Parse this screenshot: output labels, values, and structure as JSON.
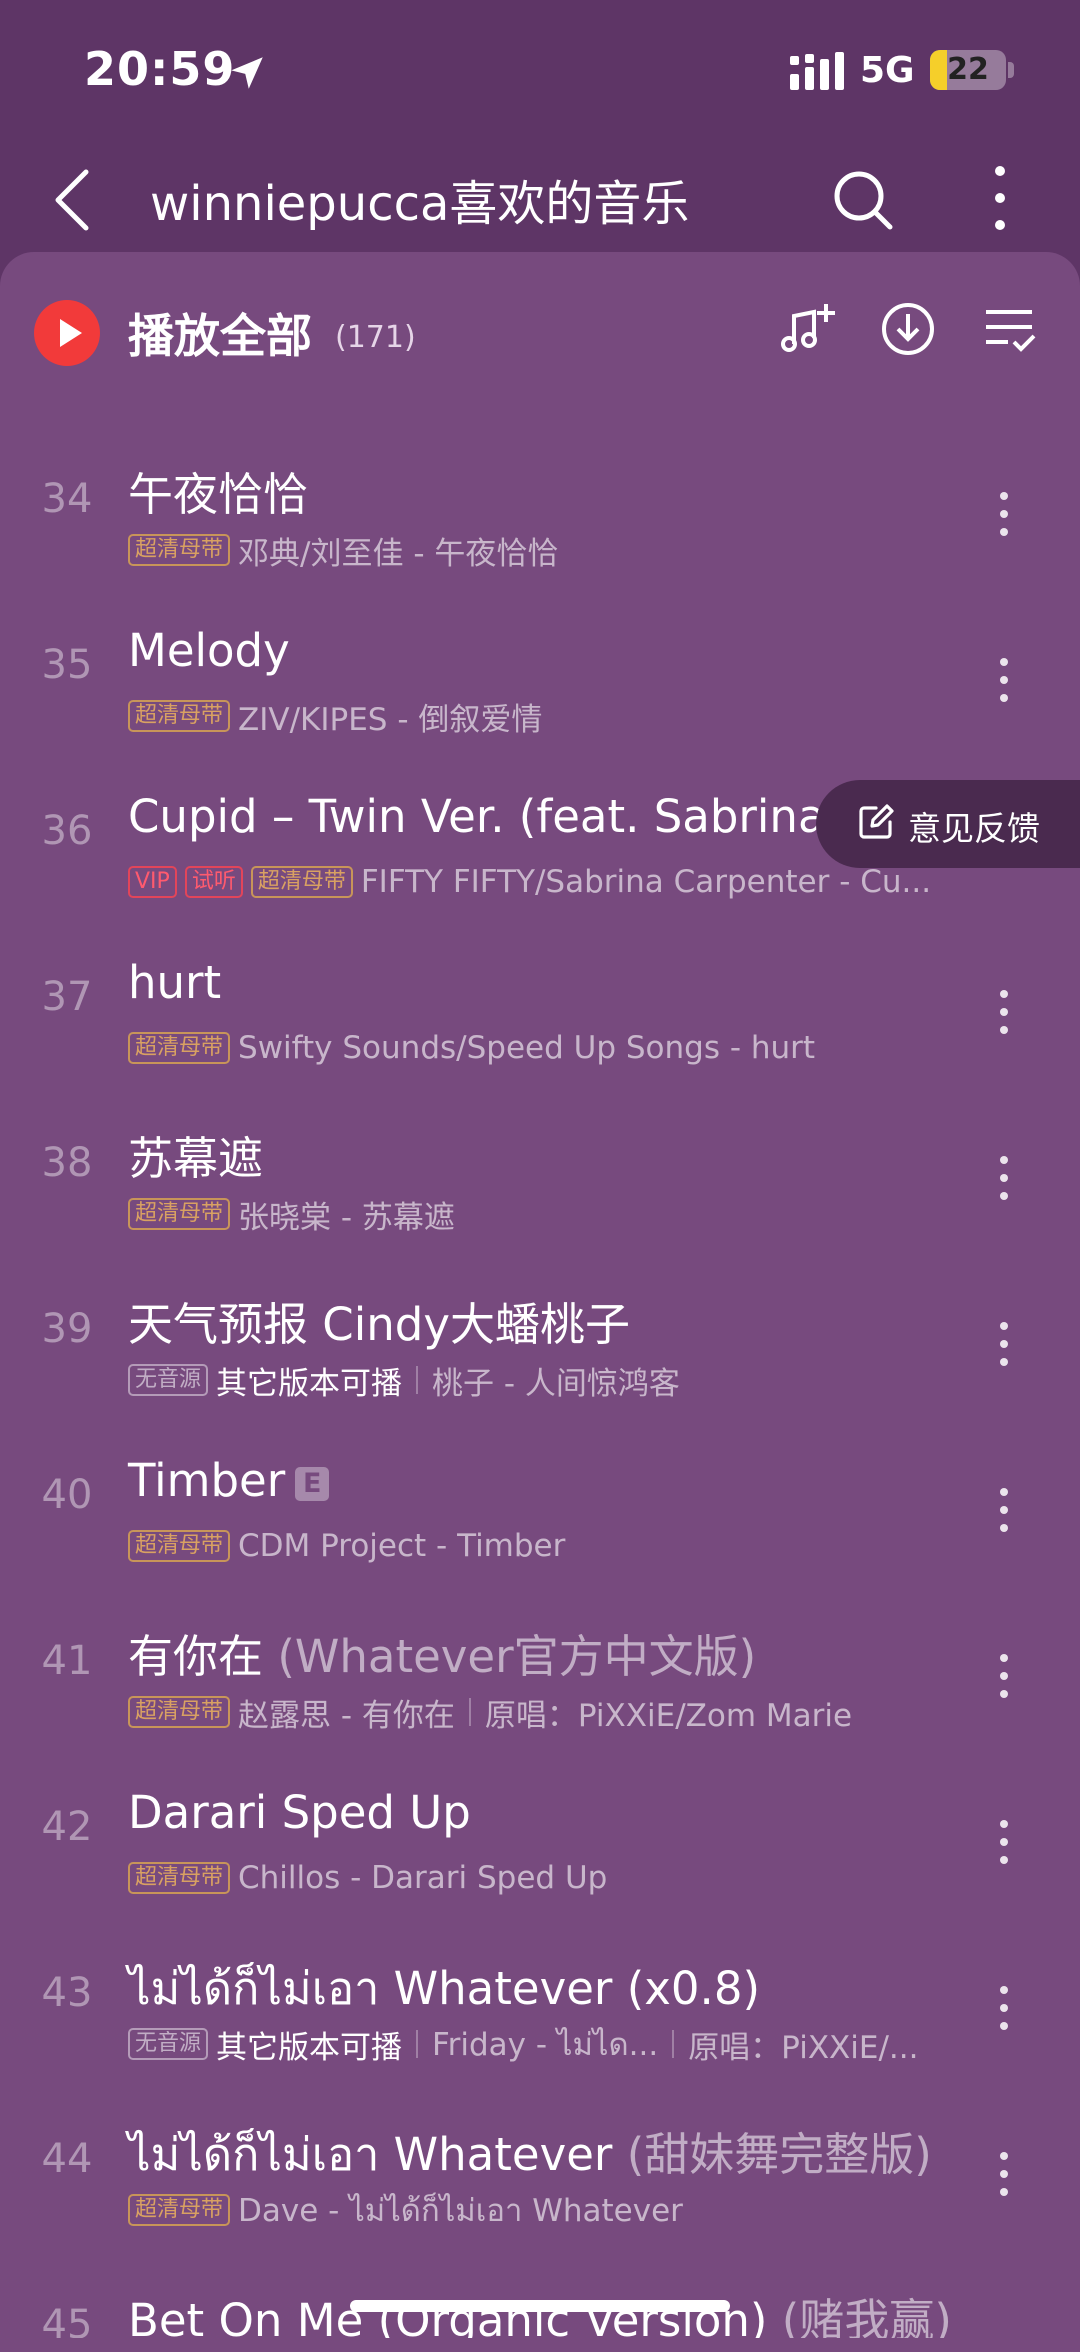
{
  "status": {
    "time": "20:59",
    "network": "5G",
    "battery": "22",
    "battery_level": 0.22
  },
  "nav": {
    "title": "winniepucca喜欢的音乐"
  },
  "play_all": {
    "label": "播放全部",
    "count": "(171)"
  },
  "feedback": {
    "label": "意见反馈"
  },
  "tracks": [
    {
      "num": "34",
      "title": "午夜恰恰",
      "badge": "超清母带",
      "meta": "邓典/刘至佳 - 午夜恰恰"
    },
    {
      "num": "35",
      "title": "Melody",
      "badge": "超清母带",
      "meta": "ZIV/KIPES - 倒叙爱情"
    },
    {
      "num": "36",
      "title": "Cupid – Twin Ver. (feat. Sabrina C",
      "badge_vip": "VIP",
      "badge_trial": "试听",
      "badge": "超清母带",
      "meta": "FIFTY FIFTY/Sabrina Carpenter - Cu..."
    },
    {
      "num": "37",
      "title": "hurt",
      "badge": "超清母带",
      "meta": "Swifty Sounds/Speed Up Songs - hurt"
    },
    {
      "num": "38",
      "title": "苏幕遮",
      "badge": "超清母带",
      "meta": "张晓棠 - 苏幕遮"
    },
    {
      "num": "39",
      "title": "天气预报 Cindy大蟠桃子",
      "badge": "无音源",
      "avail": "其它版本可播",
      "meta": "桃子 - 人间惊鸿客"
    },
    {
      "num": "40",
      "title": "Timber",
      "explicit": "E",
      "badge": "超清母带",
      "meta": "CDM Project - Timber"
    },
    {
      "num": "41",
      "title": "有你在",
      "title_sub": " (Whatever官方中文版)",
      "badge": "超清母带",
      "meta": "赵露思 - 有你在",
      "meta2": "原唱：PiXXiE/Zom Marie"
    },
    {
      "num": "42",
      "title": "Darari Sped Up",
      "badge": "超清母带",
      "meta": "Chillos - Darari Sped Up"
    },
    {
      "num": "43",
      "title": "ไม่ได้ก็ไม่เอา Whatever (x0.8)",
      "badge": "无音源",
      "avail": "其它版本可播",
      "meta": "Friday - ไม่ได...",
      "meta2": "原唱：PiXXiE/..."
    },
    {
      "num": "44",
      "title": "ไม่ได้ก็ไม่เอา Whatever",
      "title_sub": " (甜妹舞完整版)",
      "badge": "超清母带",
      "meta": "Dave - ไม่ได้ก็ไม่เอา Whatever"
    },
    {
      "num": "45",
      "title": "Bet On Me (Organic Version)",
      "title_sub": " (赌我赢)"
    }
  ]
}
